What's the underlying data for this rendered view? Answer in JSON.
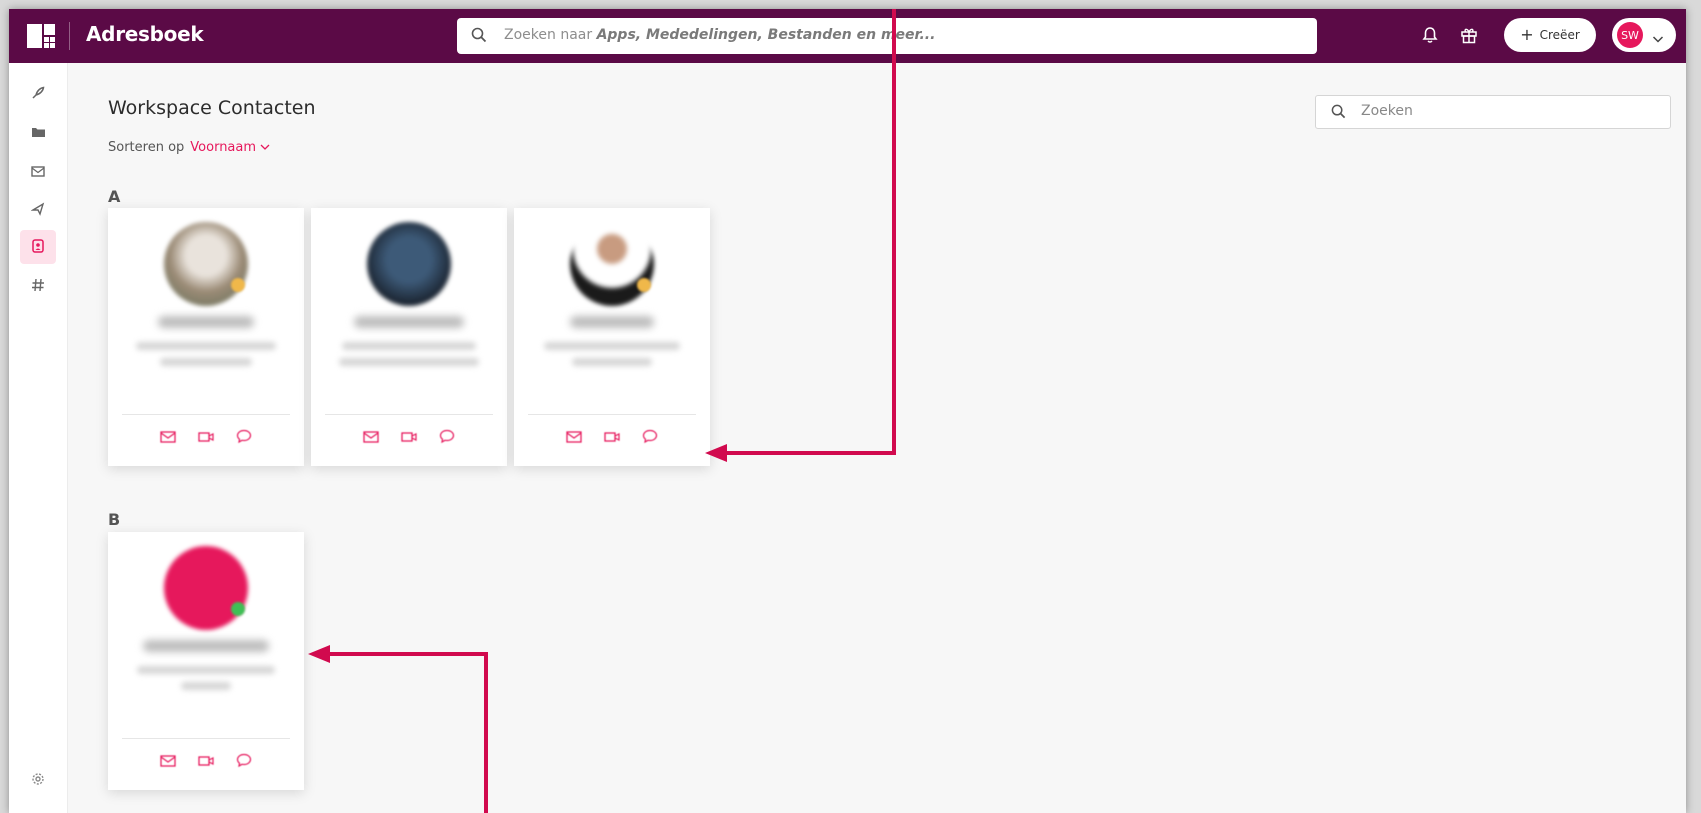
{
  "app": {
    "title": "Adresboek"
  },
  "header": {
    "search_prefix": "Zoeken naar ",
    "search_emph": "Apps, Mededelingen, Bestanden en meer...",
    "create_label": "Creëer",
    "user_initials": "SW"
  },
  "sidebar": {
    "items": [
      {
        "icon": "rocket-icon"
      },
      {
        "icon": "folder-icon"
      },
      {
        "icon": "mail-icon"
      },
      {
        "icon": "share-icon"
      },
      {
        "icon": "contacts-icon",
        "active": true
      },
      {
        "icon": "hashtag-icon"
      },
      {
        "icon": "settings-icon"
      }
    ]
  },
  "page": {
    "title": "Workspace Contacten",
    "sort_label": "Sorteren op",
    "sort_value": "Voornaam",
    "search_placeholder": "Zoeken"
  },
  "groups": [
    {
      "letter": "A",
      "contacts": 3
    },
    {
      "letter": "B",
      "contacts": 1
    }
  ],
  "colors": {
    "topbar": "#5b0a46",
    "accent": "#e6185c",
    "annotation_arrow": "#d10a4e"
  }
}
